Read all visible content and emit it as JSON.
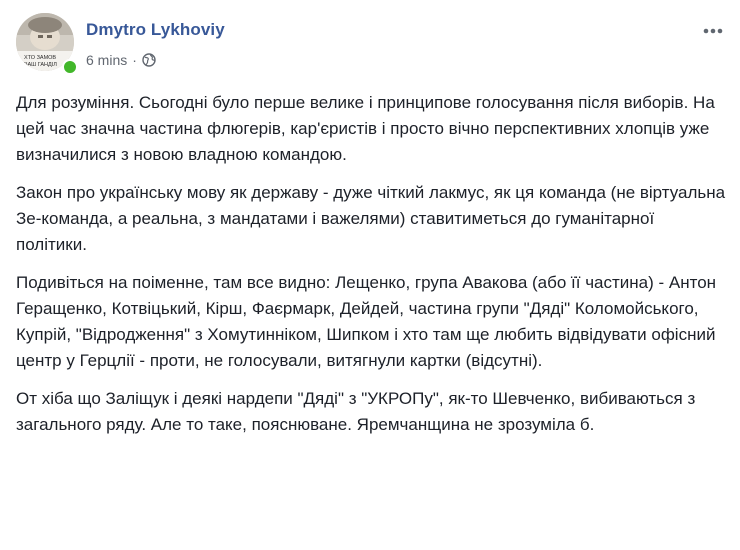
{
  "post": {
    "author": "Dmytro Lykhoviy",
    "avatar_caption_line1": "ХТО ЗАМОВ",
    "avatar_caption_line2": "ВАШ ГАНДІЛ",
    "timestamp": "6 mins",
    "separator": "·",
    "privacy_icon": "globe-icon",
    "options_icon": "more-options-icon",
    "online_status_color": "#42b72a",
    "name_color": "#385898",
    "paragraphs": [
      "Для розуміння. Сьогодні було перше велике і принципове голосування після виборів. На цей час значна частина флюгерів, кар'єристів і просто вічно перспективних хлопців уже визначилися з новою владною командою.",
      "Закон про українську мову як державу - дуже чіткий лакмус, як ця команда (не віртуальна Зе-команда, а реальна, з мандатами і важелями) ставитиметься до гуманітарної політики.",
      "Подивіться на поіменне, там все видно: Лещенко, група Авакова (або її частина) - Антон Геращенко, Котвіцький, Кірш, Фаєрмарк, Дейдей, частина групи \"Дяді\" Коломойського, Купрій, \"Відродження\" з Хомутинніком, Шипком і хто там ще любить відвідувати офісний центр у Герцлії - проти, не голосували, витягнули картки (відсутні).",
      "От хіба що Заліщук і деякі нардепи \"Дяді\" з \"УКРОПу\", як-то Шевченко, вибиваються з загального ряду. Але то таке, пояснюване. Яремчанщина не зрозуміла б."
    ]
  }
}
